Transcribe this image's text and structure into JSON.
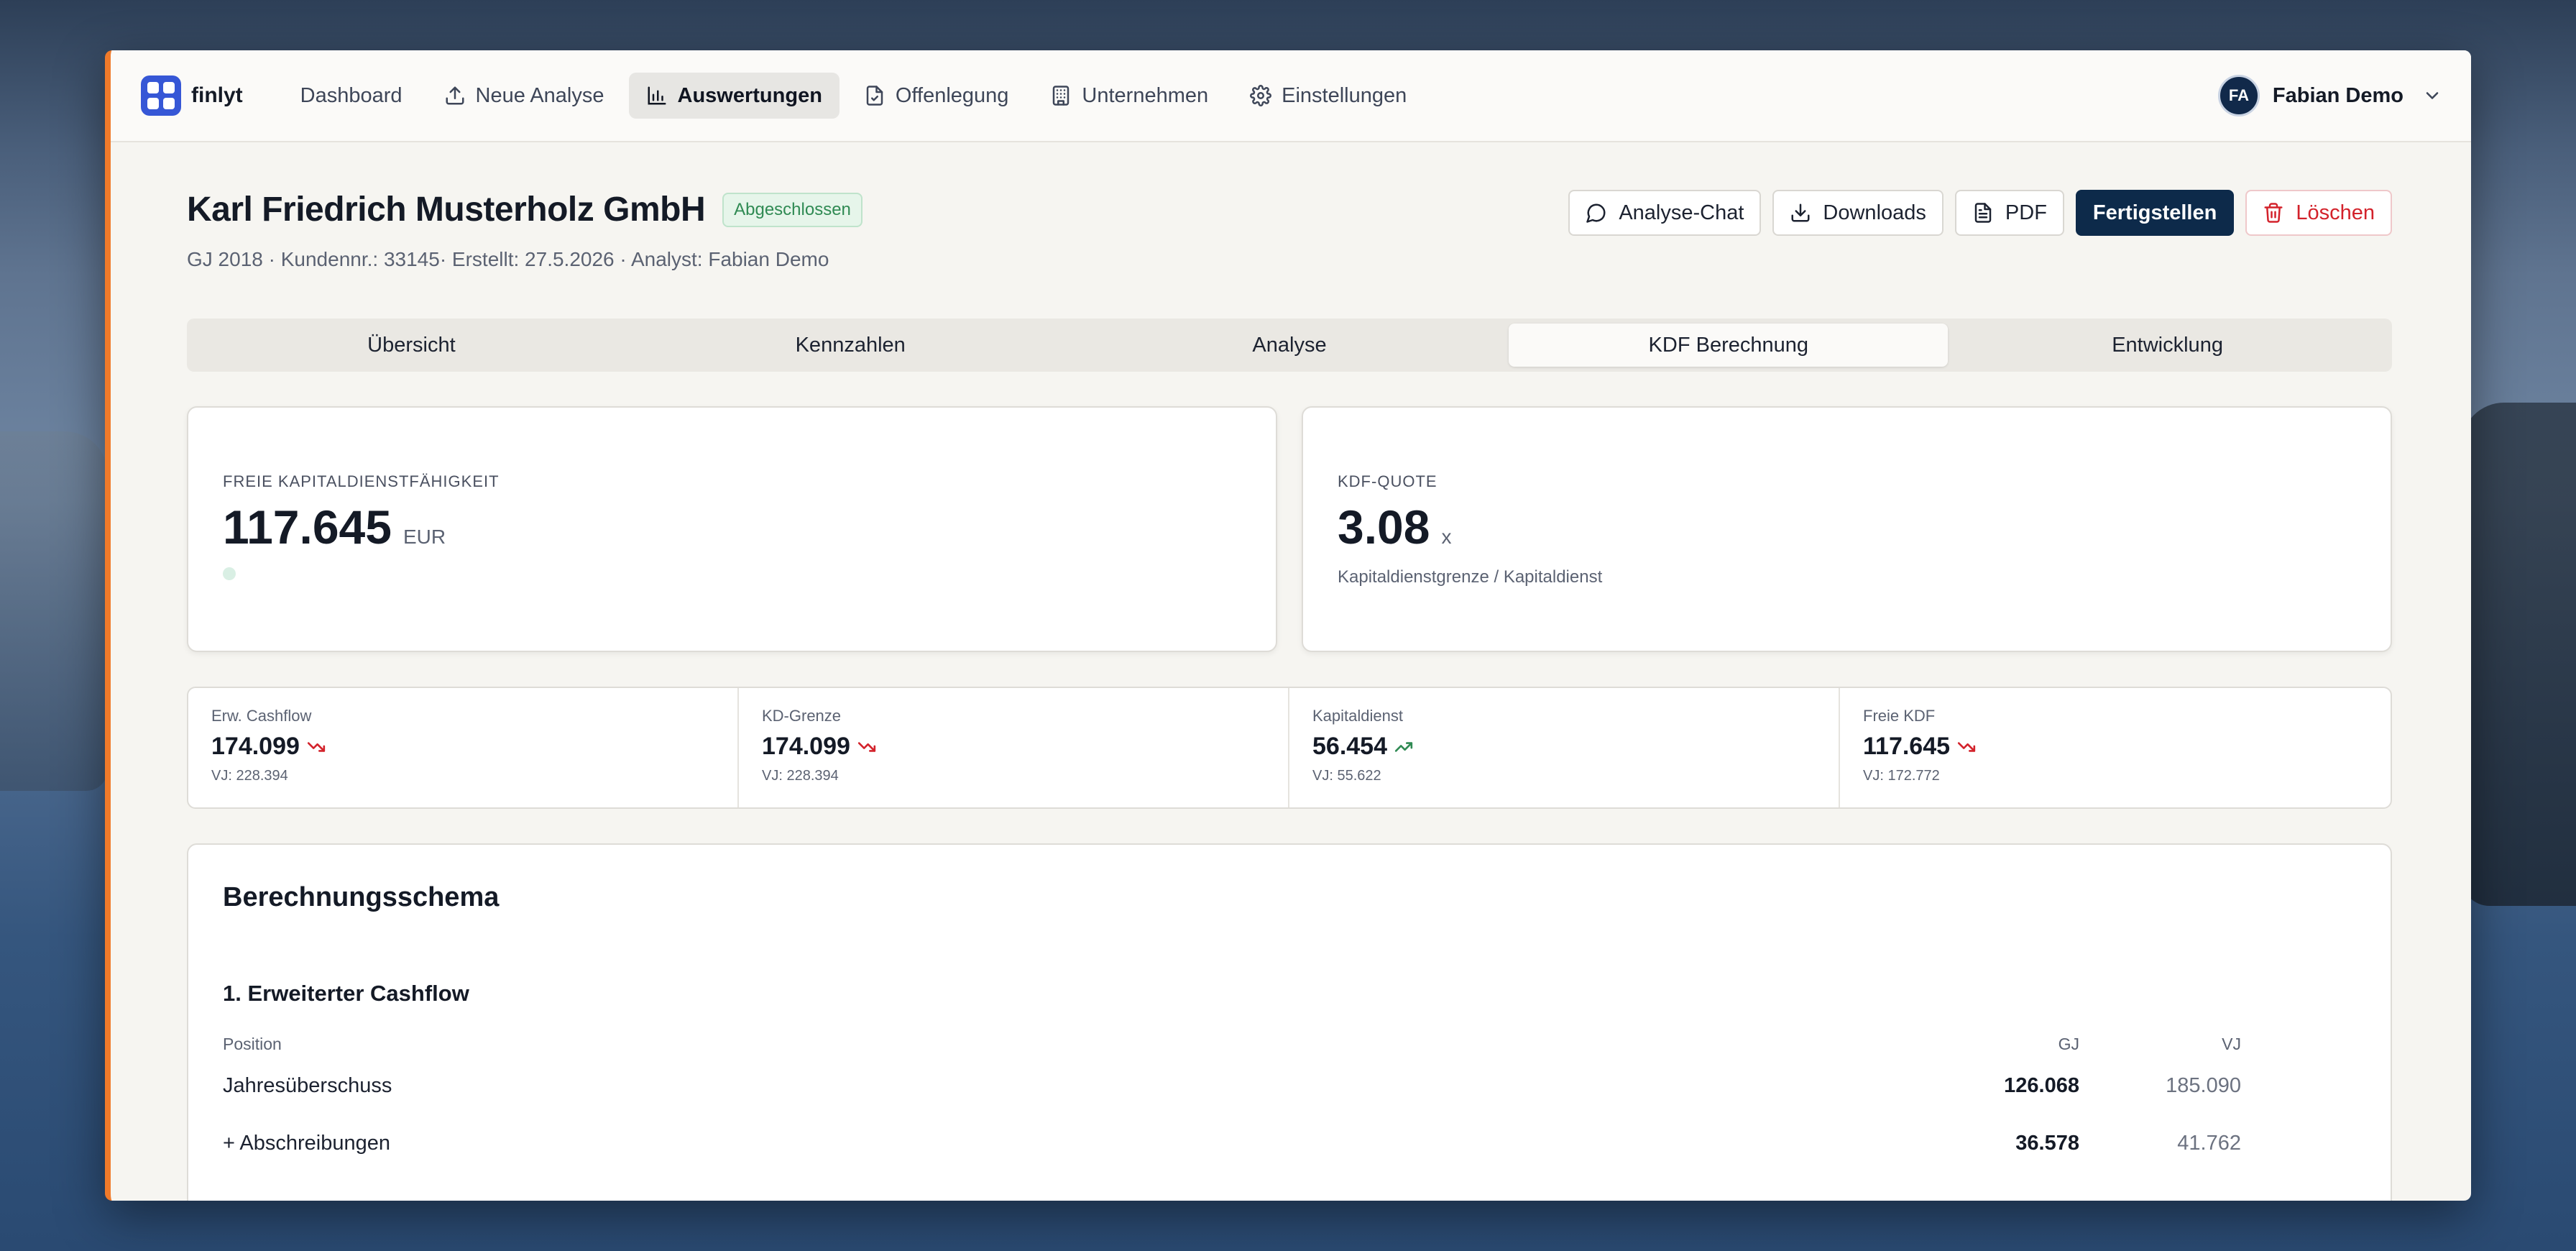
{
  "app": {
    "name": "finlyt"
  },
  "nav": [
    {
      "label": "Dashboard",
      "icon": "none"
    },
    {
      "label": "Neue Analyse",
      "icon": "upload-icon"
    },
    {
      "label": "Auswertungen",
      "icon": "bar-chart-icon",
      "active": true
    },
    {
      "label": "Offenlegung",
      "icon": "document-check-icon"
    },
    {
      "label": "Unternehmen",
      "icon": "building-icon"
    },
    {
      "label": "Einstellungen",
      "icon": "gear-icon"
    }
  ],
  "user": {
    "initials": "FA",
    "name": "Fabian Demo"
  },
  "header": {
    "company": "Karl Friedrich Musterholz GmbH",
    "status": "Abgeschlossen",
    "meta": "GJ 2018 · Kundennr.: 33145· Erstellt: 27.5.2026 · Analyst: Fabian Demo"
  },
  "actions": {
    "chat": "Analyse-Chat",
    "downloads": "Downloads",
    "pdf": "PDF",
    "finish": "Fertigstellen",
    "delete": "Löschen"
  },
  "tabs": [
    "Übersicht",
    "Kennzahlen",
    "Analyse",
    "KDF Berechnung",
    "Entwicklung"
  ],
  "active_tab": "KDF Berechnung",
  "cards": {
    "kdf": {
      "label": "Freie Kapitaldienstfähigkeit",
      "value": "117.645",
      "unit": "EUR"
    },
    "quote": {
      "label": "KDF-Quote",
      "value": "3.08",
      "unit": "x",
      "note": "Kapitaldienstgrenze / Kapitaldienst"
    }
  },
  "stats": [
    {
      "label": "Erw. Cashflow",
      "value": "174.099",
      "trend": "down",
      "prev": "VJ: 228.394"
    },
    {
      "label": "KD-Grenze",
      "value": "174.099",
      "trend": "down",
      "prev": "VJ: 228.394"
    },
    {
      "label": "Kapitaldienst",
      "value": "56.454",
      "trend": "up",
      "prev": "VJ: 55.622"
    },
    {
      "label": "Freie KDF",
      "value": "117.645",
      "trend": "down",
      "prev": "VJ: 172.772"
    }
  ],
  "colors": {
    "trend_down": "#d3222b",
    "trend_up": "#2f8a53",
    "accent": "#3657d6",
    "primary": "#0d2a4a"
  },
  "schema": {
    "title": "Berechnungsschema",
    "section": "1. Erweiterter Cashflow",
    "columns": {
      "position": "Position",
      "gj": "GJ",
      "vj": "VJ"
    },
    "rows": [
      {
        "label": "Jahresüberschuss",
        "gj": "126.068",
        "vj": "185.090"
      },
      {
        "label": "+ Abschreibungen",
        "gj": "36.578",
        "vj": "41.762"
      }
    ]
  }
}
